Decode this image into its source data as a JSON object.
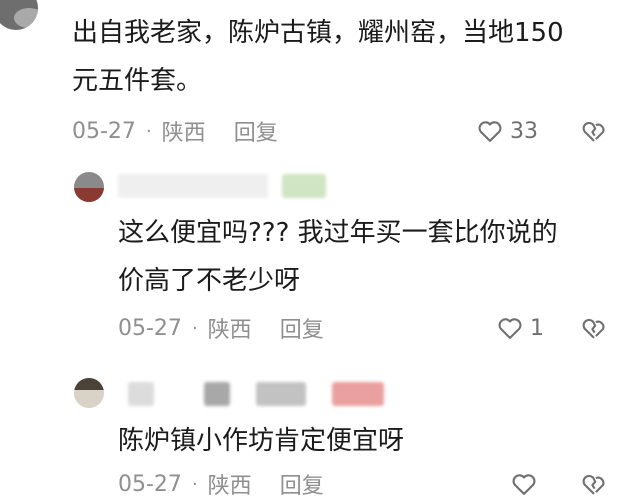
{
  "comments": [
    {
      "text_line1": "出自我老家，陈炉古镇，耀州窑，当地150",
      "text_line2": "元五件套。",
      "date": "05-27",
      "separator": "·",
      "location": "陕西",
      "reply_label": "回复",
      "likes": "33"
    },
    {
      "text_line1": "这么便宜吗??? 我过年买一套比你说的",
      "text_line2": "价高了不老少呀",
      "date": "05-27",
      "separator": "·",
      "location": "陕西",
      "reply_label": "回复",
      "likes": "1"
    },
    {
      "text_line1": "陈炉镇小作坊肯定便宜呀",
      "date": "05-27",
      "separator": "·",
      "location": "陕西",
      "reply_label": "回复",
      "likes": ""
    }
  ],
  "colors": {
    "text": "#1b1b1b",
    "meta": "#8f8f8f",
    "icon": "#6f6f6f"
  },
  "icons": {
    "like": "heart-outline-icon",
    "dislike": "broken-heart-icon"
  }
}
